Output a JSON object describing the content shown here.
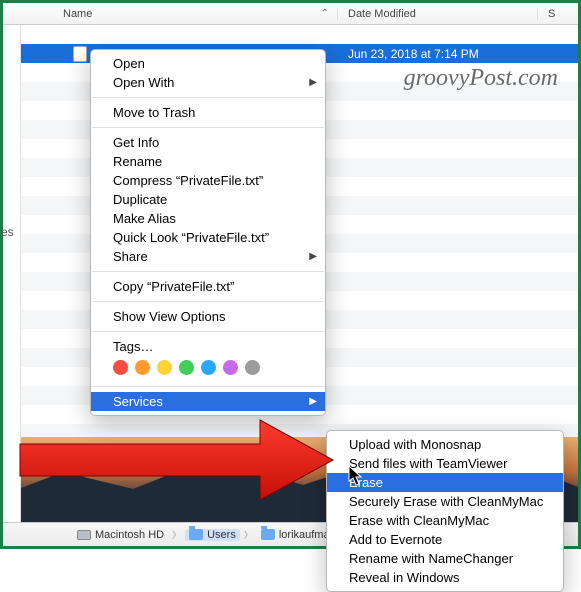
{
  "columns": {
    "name": "Name",
    "date": "Date Modified",
    "size": "S"
  },
  "selected_row": {
    "date": "Jun 23, 2018 at 7:14 PM"
  },
  "watermark": "groovyPost.com",
  "menu1": {
    "open": "Open",
    "open_with": "Open With",
    "trash": "Move to Trash",
    "getinfo": "Get Info",
    "rename": "Rename",
    "compress": "Compress “PrivateFile.txt”",
    "duplicate": "Duplicate",
    "alias": "Make Alias",
    "quicklook": "Quick Look “PrivateFile.txt”",
    "share": "Share",
    "copy": "Copy “PrivateFile.txt”",
    "viewopts": "Show View Options",
    "tags": "Tags…",
    "services": "Services"
  },
  "tag_colors": [
    "#ff4b42",
    "#ff9a2e",
    "#ffd235",
    "#41cf5a",
    "#2aa8ff",
    "#c869e8",
    "#9b9b9b"
  ],
  "menu2": {
    "monosnap": "Upload with Monosnap",
    "teamviewer": "Send files with TeamViewer",
    "erase": "Erase",
    "secure_erase": "Securely Erase with CleanMyMac",
    "erase_cmm": "Erase with CleanMyMac",
    "evernote": "Add to Evernote",
    "namechanger": "Rename with NameChanger",
    "reveal": "Reveal in Windows"
  },
  "path": {
    "seg1": "Macintosh HD",
    "seg2": "Users",
    "seg3": "lorikaufman"
  },
  "sidebar_fragment": "es"
}
